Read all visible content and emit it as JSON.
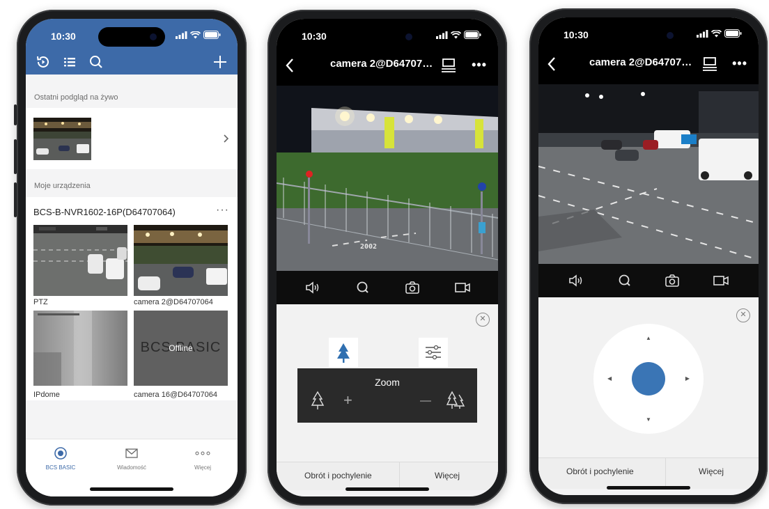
{
  "status": {
    "time": "10:30"
  },
  "phone1": {
    "recent_label": "Ostatni podgląd na żywo",
    "devices_label": "Moje urządzenia",
    "nvr_name": "BCS-B-NVR1602-16P(D64707064)",
    "nvr_more": "···",
    "cameras": [
      {
        "label": "PTZ"
      },
      {
        "label": "camera 2@D64707064"
      },
      {
        "label": "IPdome"
      },
      {
        "label": "camera 16@D64707064",
        "watermark": "BCS BASIC",
        "status": "Offline"
      }
    ],
    "tabs": [
      {
        "label": "BCS BASIC",
        "icon": "camera-lens-icon",
        "active": true
      },
      {
        "label": "Wiadomość",
        "icon": "envelope-icon"
      },
      {
        "label": "Więcej",
        "icon": "more-dots-icon"
      }
    ],
    "accent": "#3d6aa8"
  },
  "phone2": {
    "title": "camera 2@D64707…",
    "overlay_text": "2002",
    "zoom_label": "Zoom",
    "zoom_plus": "+",
    "zoom_minus": "—",
    "tab_left": "Obrót i pochylenie",
    "tab_right": "Więcej"
  },
  "phone3": {
    "title": "camera 2@D64707…",
    "tab_left": "Obrót i pochylenie",
    "tab_right": "Więcej",
    "ptz_up": "▲",
    "ptz_down": "▼",
    "ptz_left": "◀",
    "ptz_right": "▶",
    "joystick_color": "#3a75b5"
  }
}
